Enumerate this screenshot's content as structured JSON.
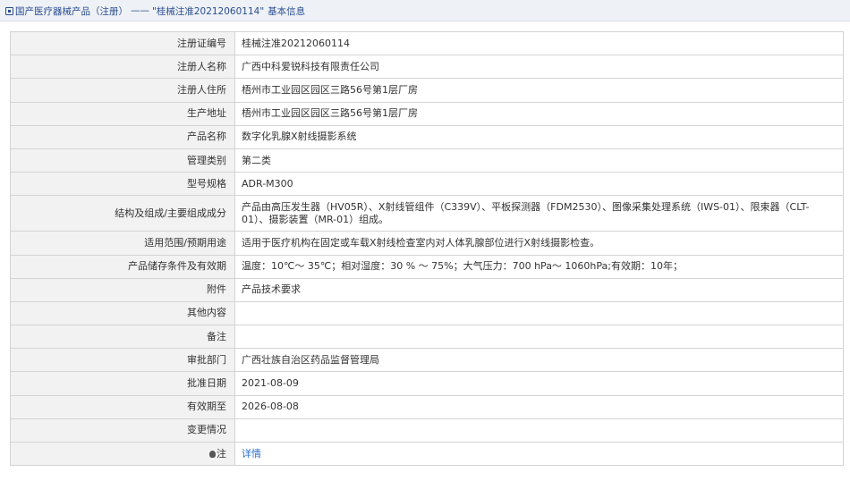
{
  "breadcrumb": {
    "part1": "国产医疗器械产品（注册）",
    "separator": "——",
    "part2": "\"桂械注准20212060114\"",
    "part3": "基本信息"
  },
  "rows": [
    {
      "label": "注册证编号",
      "value": "桂械注准20212060114"
    },
    {
      "label": "注册人名称",
      "value": "广西中科爱锐科技有限责任公司"
    },
    {
      "label": "注册人住所",
      "value": "梧州市工业园区园区三路56号第1层厂房"
    },
    {
      "label": "生产地址",
      "value": "梧州市工业园区园区三路56号第1层厂房"
    },
    {
      "label": "产品名称",
      "value": "数字化乳腺X射线摄影系统"
    },
    {
      "label": "管理类别",
      "value": "第二类"
    },
    {
      "label": "型号规格",
      "value": "ADR-M300"
    },
    {
      "label": "结构及组成/主要组成成分",
      "value": "产品由高压发生器（HV05R）、X射线管组件（C339V）、平板探测器（FDM2530）、图像采集处理系统（IWS-01）、限束器（CLT-01）、摄影装置（MR-01）组成。"
    },
    {
      "label": "适用范围/预期用途",
      "value": "适用于医疗机构在固定或车载X射线检查室内对人体乳腺部位进行X射线摄影检查。"
    },
    {
      "label": "产品储存条件及有效期",
      "value": "温度：10℃～ 35℃；相对湿度：30 % ～ 75%；大气压力：700 hPa～ 1060hPa;有效期：10年；"
    },
    {
      "label": "附件",
      "value": "产品技术要求"
    },
    {
      "label": "其他内容",
      "value": ""
    },
    {
      "label": "备注",
      "value": ""
    },
    {
      "label": "审批部门",
      "value": "广西壮族自治区药品监督管理局"
    },
    {
      "label": "批准日期",
      "value": "2021-08-09"
    },
    {
      "label": "有效期至",
      "value": "2026-08-08"
    },
    {
      "label": "变更情况",
      "value": ""
    },
    {
      "label": "注",
      "value": "详情"
    }
  ]
}
